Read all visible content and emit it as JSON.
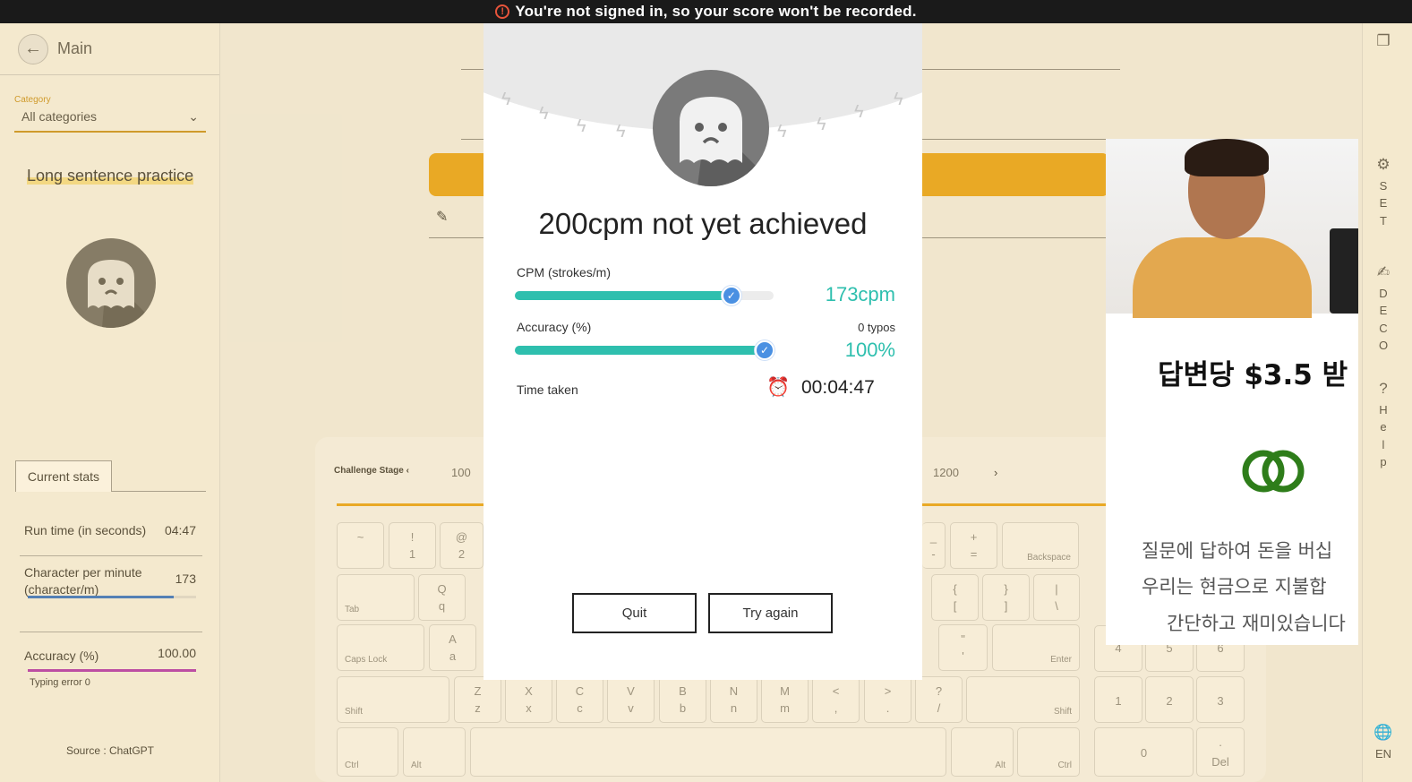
{
  "banner": {
    "icon": "warning-icon",
    "text": "You're not signed in, so your score won't be recorded."
  },
  "sidebar": {
    "back_label": "Main",
    "category_label": "Category",
    "category_value": "All categories",
    "practice_title": "Long sentence practice",
    "stats_tab": "Current stats",
    "run_time_label": "Run time (in seconds)",
    "run_time_value": "04:47",
    "cpm_label_1": "Character per minute",
    "cpm_label_2": "(character/m)",
    "cpm_value": "173",
    "cpm_fraction": 0.865,
    "accuracy_label": "Accuracy (%)",
    "accuracy_value": "100.00",
    "accuracy_fraction": 1.0,
    "typing_error": "Typing error 0",
    "source": "Source : ChatGPT"
  },
  "stage": {
    "label": "Challenge Stage",
    "first": "100",
    "last": "1200"
  },
  "keyboard": {
    "row1": [
      [
        "~",
        ""
      ],
      [
        "!",
        "1"
      ],
      [
        "@",
        "2"
      ]
    ],
    "row1_right": [
      [
        "_",
        "-"
      ],
      [
        "+",
        "="
      ]
    ],
    "backspace": "Backspace",
    "tab": "Tab",
    "q": [
      "Q",
      "q"
    ],
    "bracket_keys": [
      [
        "{",
        "["
      ],
      [
        "}",
        "]"
      ],
      [
        "|",
        "\\"
      ]
    ],
    "caps": "Caps Lock",
    "a": [
      "A",
      "a"
    ],
    "quote": [
      "\"",
      "'"
    ],
    "enter": "Enter",
    "shift": "Shift",
    "shift_right": "Shift",
    "bottom_letters": [
      [
        "Z",
        "z"
      ],
      [
        "X",
        "x"
      ],
      [
        "C",
        "c"
      ],
      [
        "V",
        "v"
      ],
      [
        "B",
        "b"
      ],
      [
        "N",
        "n"
      ],
      [
        "M",
        "m"
      ],
      [
        "<",
        ","
      ],
      [
        ">",
        "."
      ],
      [
        "?",
        "/"
      ]
    ],
    "ctrl": "Ctrl",
    "alt": "Alt",
    "alt_right": "Alt",
    "ctrl_right": "Ctrl",
    "numpad": [
      "4",
      "5",
      "6",
      "1",
      "2",
      "3",
      "0"
    ],
    "del": "Del",
    "del_dot": "."
  },
  "rail": {
    "set": "SET",
    "deco": "DECO",
    "help": "Help",
    "lang": "EN"
  },
  "modal": {
    "title": "200cpm not yet achieved",
    "cpm_label": "CPM (strokes/m)",
    "cpm_value": "173cpm",
    "cpm_fraction": 0.84,
    "accuracy_label": "Accuracy (%)",
    "typos": "0 typos",
    "accuracy_value": "100%",
    "accuracy_fraction": 1.0,
    "time_label": "Time taken",
    "time_value": "00:04:47",
    "quit": "Quit",
    "retry": "Try again"
  },
  "ad": {
    "title": "답변당 $3.5 받",
    "line1": "질문에 답하여 돈을 버십",
    "line2": "우리는 현금으로 지불합",
    "line3": "간단하고 재미있습니다",
    "logo_color": "#2e7d1a"
  }
}
